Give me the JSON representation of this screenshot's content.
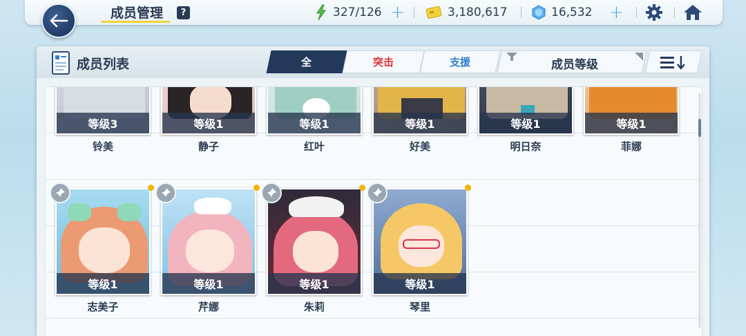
{
  "header": {
    "title": "成员管理",
    "help_label": "?",
    "energy": "327/126",
    "credits": "3,180,617",
    "gems": "16,532"
  },
  "panel": {
    "title": "成员列表",
    "tabs": [
      "全",
      "突击",
      "支援"
    ],
    "sort_label": "成员等级"
  },
  "members_row1": [
    {
      "name": "铃美",
      "level": "等级3",
      "bg": "#c9cfd8",
      "hair": "#d8dde4"
    },
    {
      "name": "静子",
      "level": "等级1",
      "bg": "#e7d3cf",
      "hair": "#2b2426"
    },
    {
      "name": "红叶",
      "level": "等级1",
      "bg": "#d7e7e8",
      "hair": "#9fcfc3"
    },
    {
      "name": "好美",
      "level": "等级1",
      "bg": "#b8a58e",
      "hair": "#e2b44a"
    },
    {
      "name": "明日奈",
      "level": "等级1",
      "bg": "#3e4a5a",
      "hair": "#c8b9a3"
    },
    {
      "name": "菲娜",
      "level": "等级1",
      "bg": "#e4c39b",
      "hair": "#e58a2e"
    }
  ],
  "members_row2": [
    {
      "name": "志美子",
      "level": "等级1",
      "bg": "#8fcde8",
      "hair": "#ec9a72"
    },
    {
      "name": "芹娜",
      "level": "等级1",
      "bg": "#a9d5ef",
      "hair": "#f2b5c0"
    },
    {
      "name": "朱莉",
      "level": "等级1",
      "bg": "#5a2b3a",
      "hair": "#e36a7e"
    },
    {
      "name": "琴里",
      "level": "等级1",
      "bg": "#6f8fb8",
      "hair": "#f5c766"
    }
  ],
  "colors": {
    "accent_dark": "#22395a",
    "assault": "#e0323a",
    "support": "#2f7fd0",
    "new_dot": "#f4b400"
  },
  "icons": [
    "back-arrow-icon",
    "energy-bolt-icon",
    "credit-card-icon",
    "gem-icon",
    "gear-icon",
    "home-icon",
    "member-list-icon",
    "filter-icon",
    "sort-order-icon",
    "pin-icon"
  ]
}
